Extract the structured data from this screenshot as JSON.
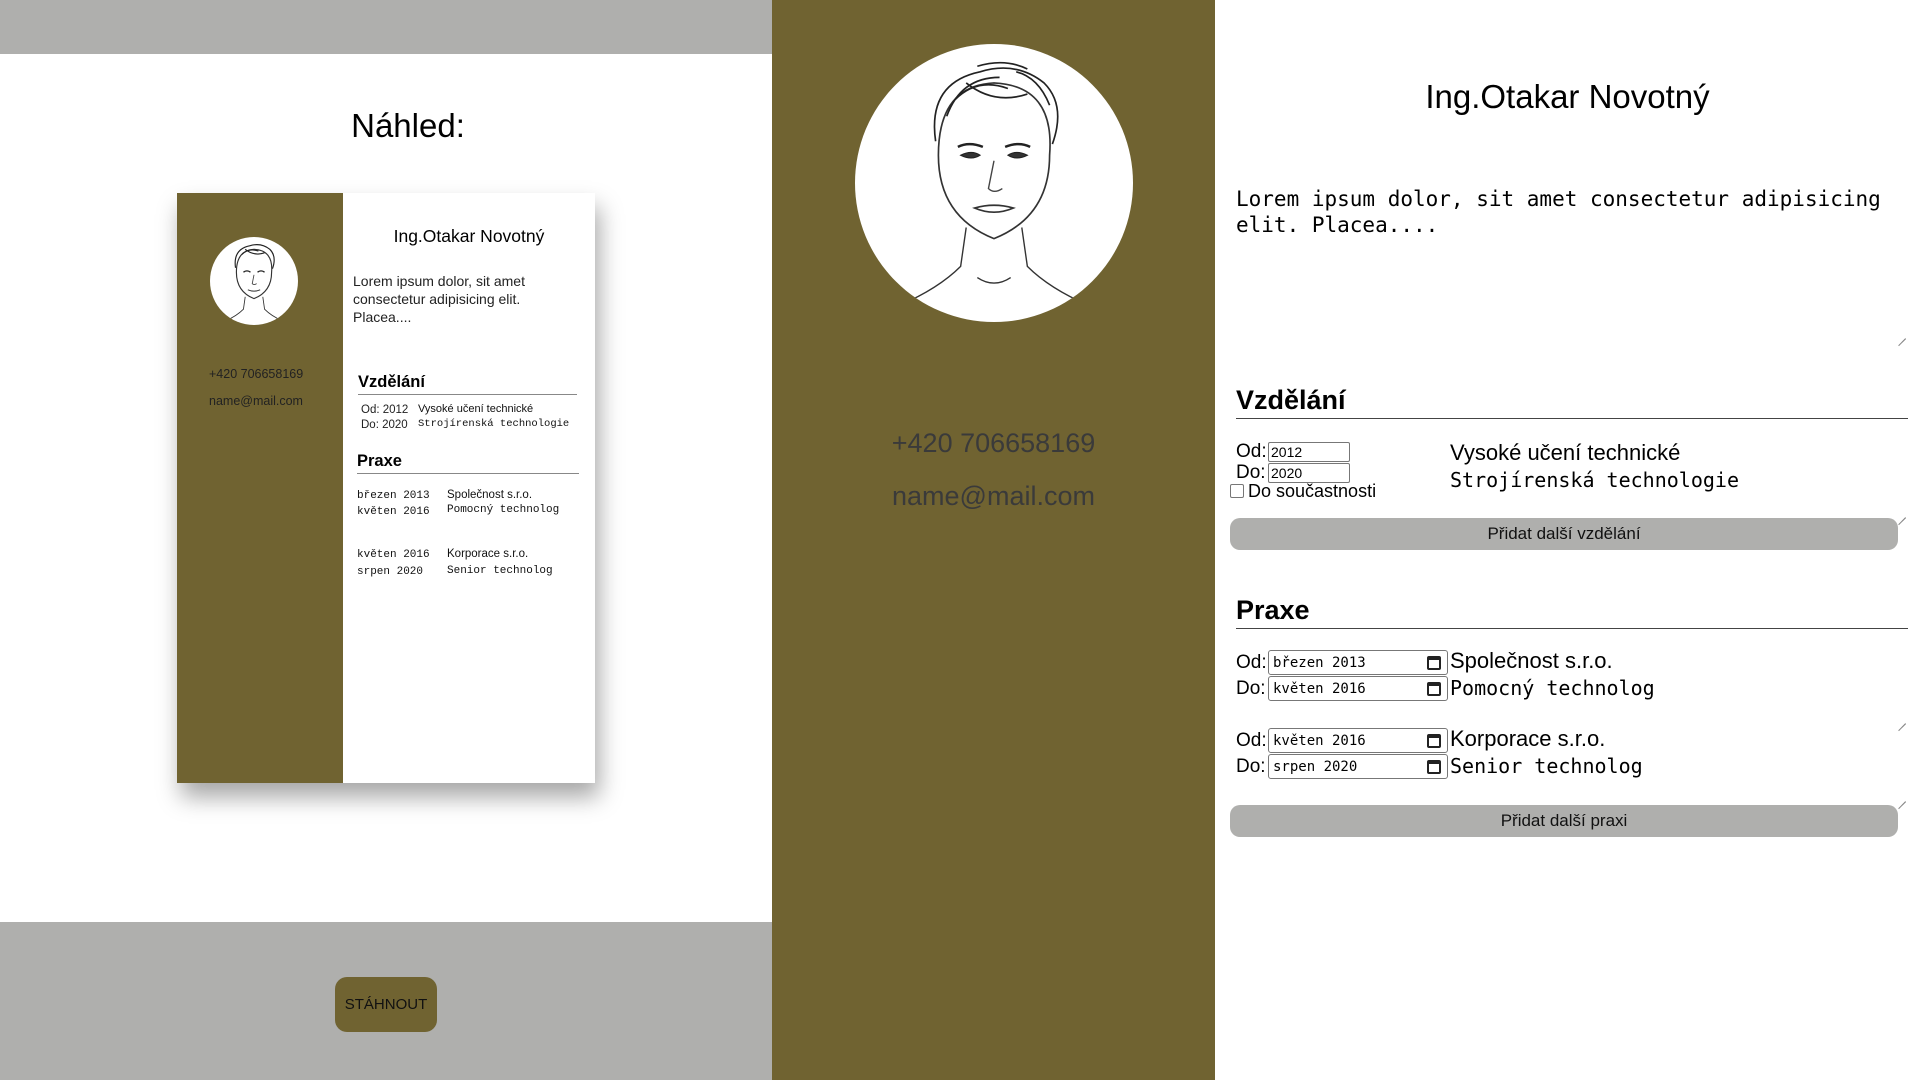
{
  "preview": {
    "title": "Náhled:",
    "download_label": "STÁHNOUT"
  },
  "cv": {
    "name": "Ing.Otakar Novotný",
    "about": "Lorem ipsum dolor, sit amet consectetur adipisicing elit. Placea....",
    "phone": "+420 706658169",
    "email": "name@mail.com",
    "education_heading": "Vzdělání",
    "practice_heading": "Praxe",
    "education": {
      "from_label": "Od:",
      "to_label": "Do:",
      "from": "2012",
      "to": "2020",
      "current_label": "Do součastnosti",
      "school": "Vysoké učení technické",
      "field": "Strojírenská technologie",
      "mini_from": "Od: 2012",
      "mini_to": "Do: 2020"
    },
    "jobs": [
      {
        "from": "březen 2013",
        "to": "květen 2016",
        "company": "Společnost s.r.o.",
        "role": "Pomocný technolog"
      },
      {
        "from": "květen 2016",
        "to": "srpen 2020",
        "company": "Korporace s.r.o.",
        "role": "Senior technolog"
      }
    ],
    "add_education_label": "Přidat další vzdělání",
    "add_practice_label": "Přidat další praxi",
    "from_label": "Od:",
    "to_label": "Do:"
  },
  "colors": {
    "accent_olive": "#706331",
    "gray_panel": "#afafad"
  },
  "icons": {
    "portrait": "avatar-sketch-icon",
    "calendar": "calendar-icon",
    "resize": "resize-handle-icon"
  }
}
